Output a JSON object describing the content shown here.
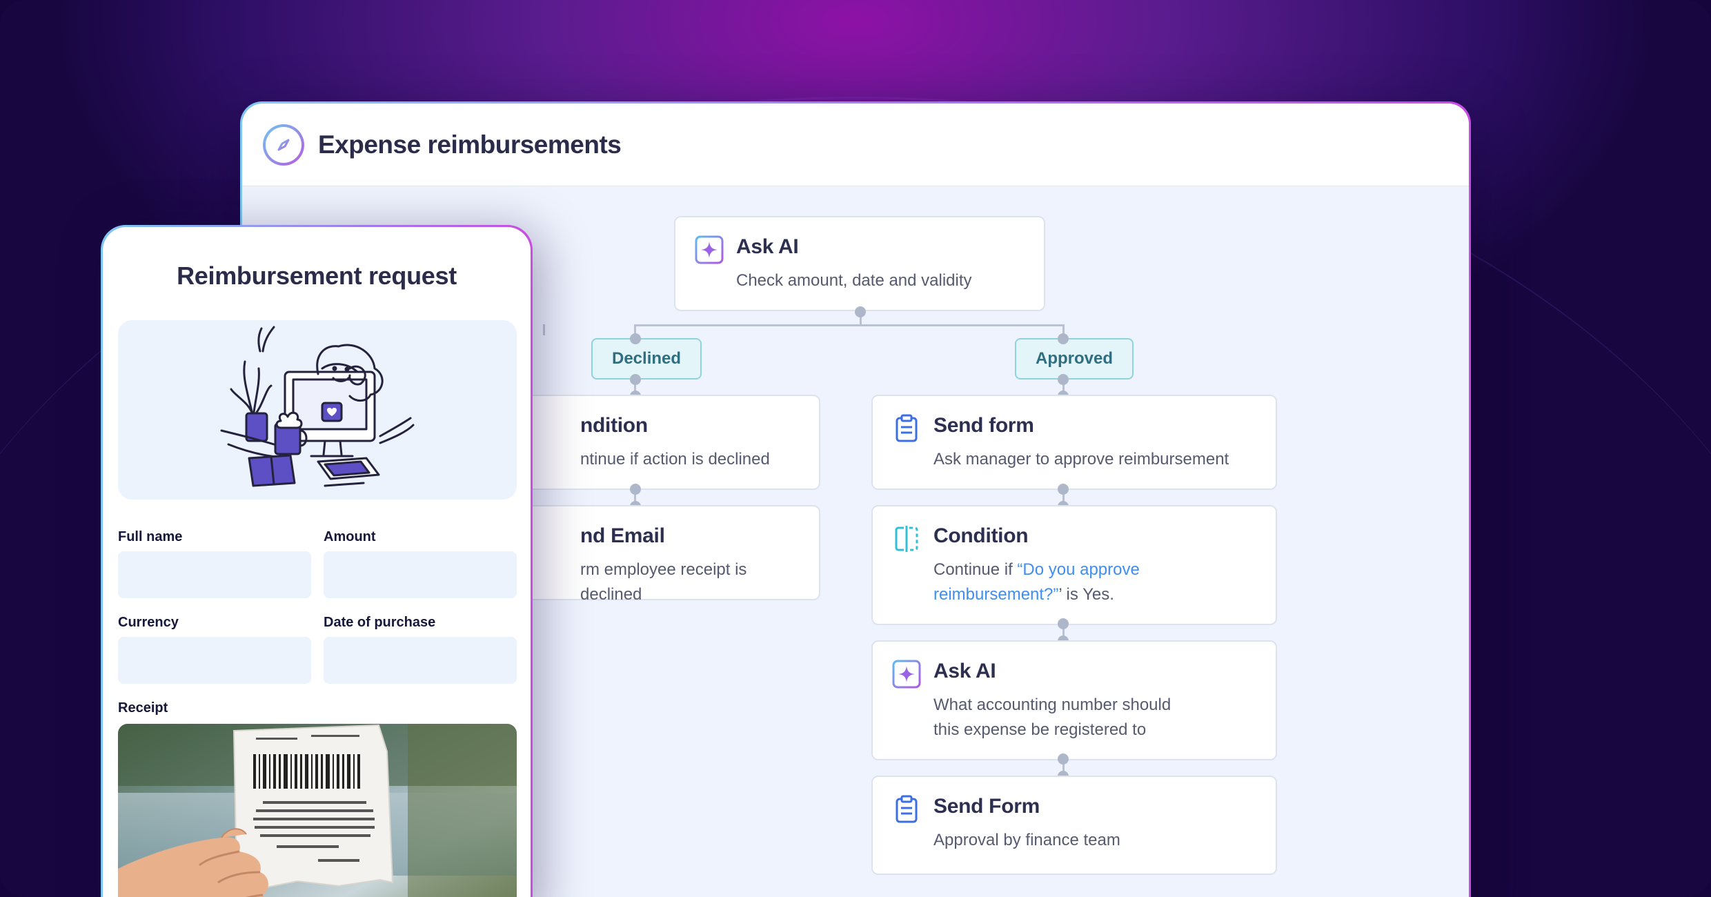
{
  "window": {
    "title": "Expense reimbursements",
    "logo_icon": "compass-icon"
  },
  "flow": {
    "ask_ai_top": {
      "title": "Ask AI",
      "subtitle": "Check amount, date and validity",
      "icon": "sparkle-icon"
    },
    "declined_label": "Declined",
    "approved_label": "Approved",
    "condition_left": {
      "title": "ndition",
      "subtitle": "ntinue if action is declined"
    },
    "email_left": {
      "title": "nd Email",
      "subtitle": "rm employee receipt is declined"
    },
    "send_form": {
      "title": "Send form",
      "subtitle": "Ask manager to approve reimbursement",
      "icon": "clipboard-icon"
    },
    "condition": {
      "title": "Condition",
      "subtitle_prefix": "Continue if ",
      "subtitle_highlight_1": "“Do you approve",
      "subtitle_highlight_2": "reimbursement?”",
      "subtitle_suffix": "’ is Yes.",
      "icon": "split-icon"
    },
    "ask_ai_2": {
      "title": "Ask AI",
      "subtitle_1": "What accounting number should",
      "subtitle_2": "this expense be registered to",
      "icon": "sparkle-icon"
    },
    "send_form_2": {
      "title": "Send Form",
      "subtitle": "Approval by finance team",
      "icon": "clipboard-icon"
    }
  },
  "form": {
    "title": "Reimbursement request",
    "fields": {
      "full_name": "Full name",
      "amount": "Amount",
      "currency": "Currency",
      "date_of_purchase": "Date of purchase",
      "receipt": "Receipt"
    }
  },
  "colors": {
    "accent_purple": "#8b5cf6",
    "tag_teal": "#2e6e80",
    "link_blue": "#3f8ef0"
  }
}
